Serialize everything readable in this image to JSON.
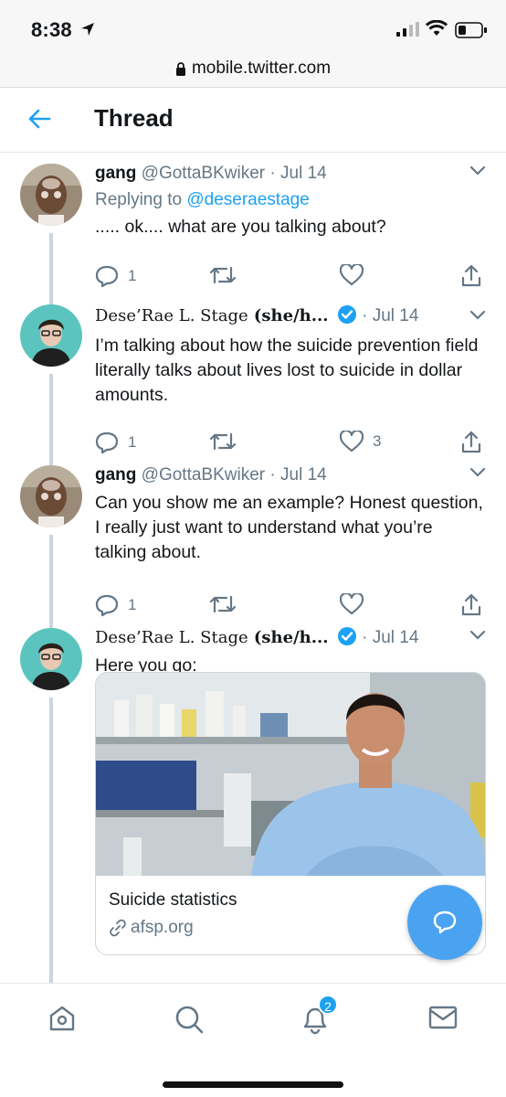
{
  "status_bar": {
    "time": "8:38"
  },
  "browser": {
    "url": "mobile.twitter.com"
  },
  "header": {
    "title": "Thread"
  },
  "tweets": [
    {
      "display_name": "gang",
      "handle": "@GottaBKwiker",
      "date": "Jul 14",
      "replying_label": "Replying to",
      "replying_to": "@deseraestage",
      "text": "..... ok.... what are you talking about?",
      "reply_count": "1",
      "retweet_count": "",
      "like_count": ""
    },
    {
      "display_name_part1": "Dese’Rae L. Stage",
      "display_name_part2": " (she/h...",
      "date": "Jul 14",
      "text": "I’m talking about how the suicide prevention field literally talks about lives lost to suicide in dollar amounts.",
      "reply_count": "1",
      "retweet_count": "",
      "like_count": "3"
    },
    {
      "display_name": "gang",
      "handle": "@GottaBKwiker",
      "date": "Jul 14",
      "text": "Can you show me an example? Honest question, I really just want to understand what you’re talking about.",
      "reply_count": "1",
      "retweet_count": "",
      "like_count": ""
    },
    {
      "display_name_part1": "Dese’Rae L. Stage",
      "display_name_part2": " (she/h...",
      "date": "Jul 14",
      "text": "Here you go:",
      "card": {
        "title": "Suicide statistics",
        "domain": "afsp.org"
      }
    }
  ],
  "nav": {
    "notifications_badge": "2"
  },
  "colors": {
    "accent": "#1da1f2",
    "fab": "#4aa3f0",
    "muted": "#657786",
    "verified": "#1da1f2"
  }
}
